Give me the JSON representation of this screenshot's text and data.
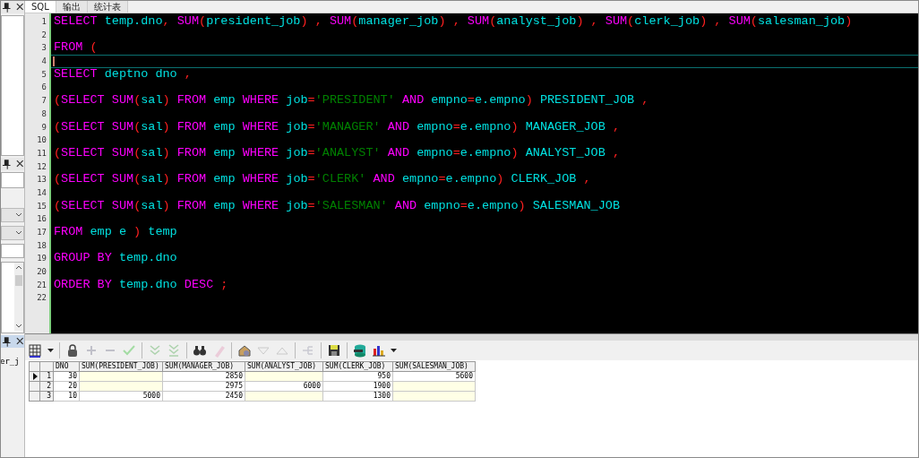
{
  "side_panel": {
    "fragment": "er_j"
  },
  "tabs": [
    {
      "label": "SQL",
      "selected": true
    },
    {
      "label": "输出",
      "selected": false
    },
    {
      "label": "统计表",
      "selected": false
    }
  ],
  "editor": {
    "lines": [
      {
        "number": "1",
        "current": false,
        "tokens": [
          {
            "kind": "keyword",
            "text": "SELECT"
          },
          {
            "kind": "ident",
            "text": " temp.dno"
          },
          {
            "kind": "punct",
            "text": ","
          },
          {
            "kind": "keyword",
            "text": " SUM"
          },
          {
            "kind": "punct",
            "text": "("
          },
          {
            "kind": "ident",
            "text": "president_job"
          },
          {
            "kind": "punct",
            "text": ") ,"
          },
          {
            "kind": "keyword",
            "text": " SUM"
          },
          {
            "kind": "punct",
            "text": "("
          },
          {
            "kind": "ident",
            "text": "manager_job"
          },
          {
            "kind": "punct",
            "text": ") ,"
          },
          {
            "kind": "keyword",
            "text": " SUM"
          },
          {
            "kind": "punct",
            "text": "("
          },
          {
            "kind": "ident",
            "text": "analyst_job"
          },
          {
            "kind": "punct",
            "text": ") ,"
          },
          {
            "kind": "keyword",
            "text": " SUM"
          },
          {
            "kind": "punct",
            "text": "("
          },
          {
            "kind": "ident",
            "text": "clerk_job"
          },
          {
            "kind": "punct",
            "text": ") ,"
          },
          {
            "kind": "keyword",
            "text": " SUM"
          },
          {
            "kind": "punct",
            "text": "("
          },
          {
            "kind": "ident",
            "text": "salesman_job"
          },
          {
            "kind": "punct",
            "text": ")"
          }
        ]
      },
      {
        "number": "2",
        "current": false
      },
      {
        "number": "3",
        "current": false,
        "tokens": [
          {
            "kind": "keyword",
            "text": "FROM"
          },
          {
            "kind": "punct",
            "text": " ("
          }
        ]
      },
      {
        "number": "4",
        "current": true
      },
      {
        "number": "5",
        "current": false,
        "tokens": [
          {
            "kind": "keyword",
            "text": "SELECT"
          },
          {
            "kind": "ident",
            "text": " deptno dno"
          },
          {
            "kind": "punct",
            "text": " ,"
          }
        ]
      },
      {
        "number": "6",
        "current": false
      },
      {
        "number": "7",
        "current": false,
        "tokens": [
          {
            "kind": "punct",
            "text": "("
          },
          {
            "kind": "keyword",
            "text": "SELECT SUM"
          },
          {
            "kind": "punct",
            "text": "("
          },
          {
            "kind": "ident",
            "text": "sal"
          },
          {
            "kind": "punct",
            "text": ")"
          },
          {
            "kind": "keyword",
            "text": " FROM"
          },
          {
            "kind": "ident",
            "text": " emp"
          },
          {
            "kind": "keyword",
            "text": " WHERE"
          },
          {
            "kind": "ident",
            "text": " job"
          },
          {
            "kind": "punct",
            "text": "="
          },
          {
            "kind": "string",
            "text": "'PRESIDENT'"
          },
          {
            "kind": "keyword",
            "text": " AND"
          },
          {
            "kind": "ident",
            "text": " empno"
          },
          {
            "kind": "punct",
            "text": "="
          },
          {
            "kind": "ident",
            "text": "e.empno"
          },
          {
            "kind": "punct",
            "text": ")"
          },
          {
            "kind": "ident",
            "text": " PRESIDENT_JOB"
          },
          {
            "kind": "punct",
            "text": " ,"
          }
        ]
      },
      {
        "number": "8",
        "current": false
      },
      {
        "number": "9",
        "current": false,
        "tokens": [
          {
            "kind": "punct",
            "text": "("
          },
          {
            "kind": "keyword",
            "text": "SELECT SUM"
          },
          {
            "kind": "punct",
            "text": "("
          },
          {
            "kind": "ident",
            "text": "sal"
          },
          {
            "kind": "punct",
            "text": ")"
          },
          {
            "kind": "keyword",
            "text": " FROM"
          },
          {
            "kind": "ident",
            "text": " emp"
          },
          {
            "kind": "keyword",
            "text": " WHERE"
          },
          {
            "kind": "ident",
            "text": " job"
          },
          {
            "kind": "punct",
            "text": "="
          },
          {
            "kind": "string",
            "text": "'MANAGER'"
          },
          {
            "kind": "keyword",
            "text": " AND"
          },
          {
            "kind": "ident",
            "text": " empno"
          },
          {
            "kind": "punct",
            "text": "="
          },
          {
            "kind": "ident",
            "text": "e.empno"
          },
          {
            "kind": "punct",
            "text": ")"
          },
          {
            "kind": "ident",
            "text": " MANAGER_JOB"
          },
          {
            "kind": "punct",
            "text": " ,"
          }
        ]
      },
      {
        "number": "10",
        "current": false
      },
      {
        "number": "11",
        "current": false,
        "tokens": [
          {
            "kind": "punct",
            "text": "("
          },
          {
            "kind": "keyword",
            "text": "SELECT SUM"
          },
          {
            "kind": "punct",
            "text": "("
          },
          {
            "kind": "ident",
            "text": "sal"
          },
          {
            "kind": "punct",
            "text": ")"
          },
          {
            "kind": "keyword",
            "text": " FROM"
          },
          {
            "kind": "ident",
            "text": " emp"
          },
          {
            "kind": "keyword",
            "text": " WHERE"
          },
          {
            "kind": "ident",
            "text": " job"
          },
          {
            "kind": "punct",
            "text": "="
          },
          {
            "kind": "string",
            "text": "'ANALYST'"
          },
          {
            "kind": "keyword",
            "text": " AND"
          },
          {
            "kind": "ident",
            "text": " empno"
          },
          {
            "kind": "punct",
            "text": "="
          },
          {
            "kind": "ident",
            "text": "e.empno"
          },
          {
            "kind": "punct",
            "text": ")"
          },
          {
            "kind": "ident",
            "text": " ANALYST_JOB"
          },
          {
            "kind": "punct",
            "text": " ,"
          }
        ]
      },
      {
        "number": "12",
        "current": false
      },
      {
        "number": "13",
        "current": false,
        "tokens": [
          {
            "kind": "punct",
            "text": "("
          },
          {
            "kind": "keyword",
            "text": "SELECT SUM"
          },
          {
            "kind": "punct",
            "text": "("
          },
          {
            "kind": "ident",
            "text": "sal"
          },
          {
            "kind": "punct",
            "text": ")"
          },
          {
            "kind": "keyword",
            "text": " FROM"
          },
          {
            "kind": "ident",
            "text": " emp"
          },
          {
            "kind": "keyword",
            "text": " WHERE"
          },
          {
            "kind": "ident",
            "text": " job"
          },
          {
            "kind": "punct",
            "text": "="
          },
          {
            "kind": "string",
            "text": "'CLERK'"
          },
          {
            "kind": "keyword",
            "text": " AND"
          },
          {
            "kind": "ident",
            "text": " empno"
          },
          {
            "kind": "punct",
            "text": "="
          },
          {
            "kind": "ident",
            "text": "e.empno"
          },
          {
            "kind": "punct",
            "text": ")"
          },
          {
            "kind": "ident",
            "text": " CLERK_JOB"
          },
          {
            "kind": "punct",
            "text": " ,"
          }
        ]
      },
      {
        "number": "14",
        "current": false
      },
      {
        "number": "15",
        "current": false,
        "tokens": [
          {
            "kind": "punct",
            "text": "("
          },
          {
            "kind": "keyword",
            "text": "SELECT SUM"
          },
          {
            "kind": "punct",
            "text": "("
          },
          {
            "kind": "ident",
            "text": "sal"
          },
          {
            "kind": "punct",
            "text": ")"
          },
          {
            "kind": "keyword",
            "text": " FROM"
          },
          {
            "kind": "ident",
            "text": " emp"
          },
          {
            "kind": "keyword",
            "text": " WHERE"
          },
          {
            "kind": "ident",
            "text": " job"
          },
          {
            "kind": "punct",
            "text": "="
          },
          {
            "kind": "string",
            "text": "'SALESMAN'"
          },
          {
            "kind": "keyword",
            "text": " AND"
          },
          {
            "kind": "ident",
            "text": " empno"
          },
          {
            "kind": "punct",
            "text": "="
          },
          {
            "kind": "ident",
            "text": "e.empno"
          },
          {
            "kind": "punct",
            "text": ")"
          },
          {
            "kind": "ident",
            "text": " SALESMAN_JOB"
          }
        ]
      },
      {
        "number": "16",
        "current": false
      },
      {
        "number": "17",
        "current": false,
        "tokens": [
          {
            "kind": "keyword",
            "text": "FROM"
          },
          {
            "kind": "ident",
            "text": " emp e"
          },
          {
            "kind": "punct",
            "text": " )"
          },
          {
            "kind": "ident",
            "text": " temp"
          }
        ]
      },
      {
        "number": "18",
        "current": false
      },
      {
        "number": "19",
        "current": false,
        "tokens": [
          {
            "kind": "keyword",
            "text": "GROUP BY"
          },
          {
            "kind": "ident",
            "text": " temp.dno"
          }
        ]
      },
      {
        "number": "20",
        "current": false
      },
      {
        "number": "21",
        "current": false,
        "tokens": [
          {
            "kind": "keyword",
            "text": "ORDER BY"
          },
          {
            "kind": "ident",
            "text": " temp.dno"
          },
          {
            "kind": "keyword",
            "text": " DESC"
          },
          {
            "kind": "punct",
            "text": " ;"
          }
        ]
      },
      {
        "number": "22",
        "current": false
      }
    ]
  },
  "toolbar": [
    {
      "kind": "grid",
      "disabled": false
    },
    {
      "kind": "lock",
      "disabled": false
    },
    {
      "kind": "plus",
      "disabled": true
    },
    {
      "kind": "minus",
      "disabled": true
    },
    {
      "kind": "check",
      "disabled": true
    },
    {
      "kind": "next",
      "disabled": true
    },
    {
      "kind": "last",
      "disabled": true
    },
    {
      "kind": "find",
      "disabled": false
    },
    {
      "kind": "clear",
      "disabled": true
    },
    {
      "kind": "query",
      "disabled": false
    },
    {
      "kind": "down",
      "disabled": true
    },
    {
      "kind": "up",
      "disabled": true
    },
    {
      "kind": "link",
      "disabled": true
    },
    {
      "kind": "save",
      "disabled": false
    },
    {
      "kind": "export",
      "disabled": false
    },
    {
      "kind": "chart",
      "disabled": false
    }
  ],
  "grid": {
    "columns": [
      "DNO",
      "SUM(PRESIDENT_JOB)",
      "SUM(MANAGER_JOB)",
      "SUM(ANALYST_JOB)",
      "SUM(CLERK_JOB)",
      "SUM(SALESMAN_JOB)"
    ],
    "rows": [
      {
        "number": "1",
        "current": true,
        "cells": [
          {
            "value": "30",
            "empty": false
          },
          {
            "empty": true
          },
          {
            "value": "2850",
            "empty": false
          },
          {
            "empty": true
          },
          {
            "value": "950",
            "empty": false
          },
          {
            "value": "5600",
            "empty": false
          }
        ]
      },
      {
        "number": "2",
        "current": false,
        "cells": [
          {
            "value": "20",
            "empty": false
          },
          {
            "empty": true
          },
          {
            "value": "2975",
            "empty": false
          },
          {
            "value": "6000",
            "empty": false
          },
          {
            "value": "1900",
            "empty": false
          },
          {
            "empty": true
          }
        ]
      },
      {
        "number": "3",
        "current": false,
        "cells": [
          {
            "value": "10",
            "empty": false
          },
          {
            "value": "5000",
            "empty": false
          },
          {
            "value": "2450",
            "empty": false
          },
          {
            "empty": true
          },
          {
            "value": "1300",
            "empty": false
          },
          {
            "empty": true
          }
        ]
      }
    ]
  }
}
